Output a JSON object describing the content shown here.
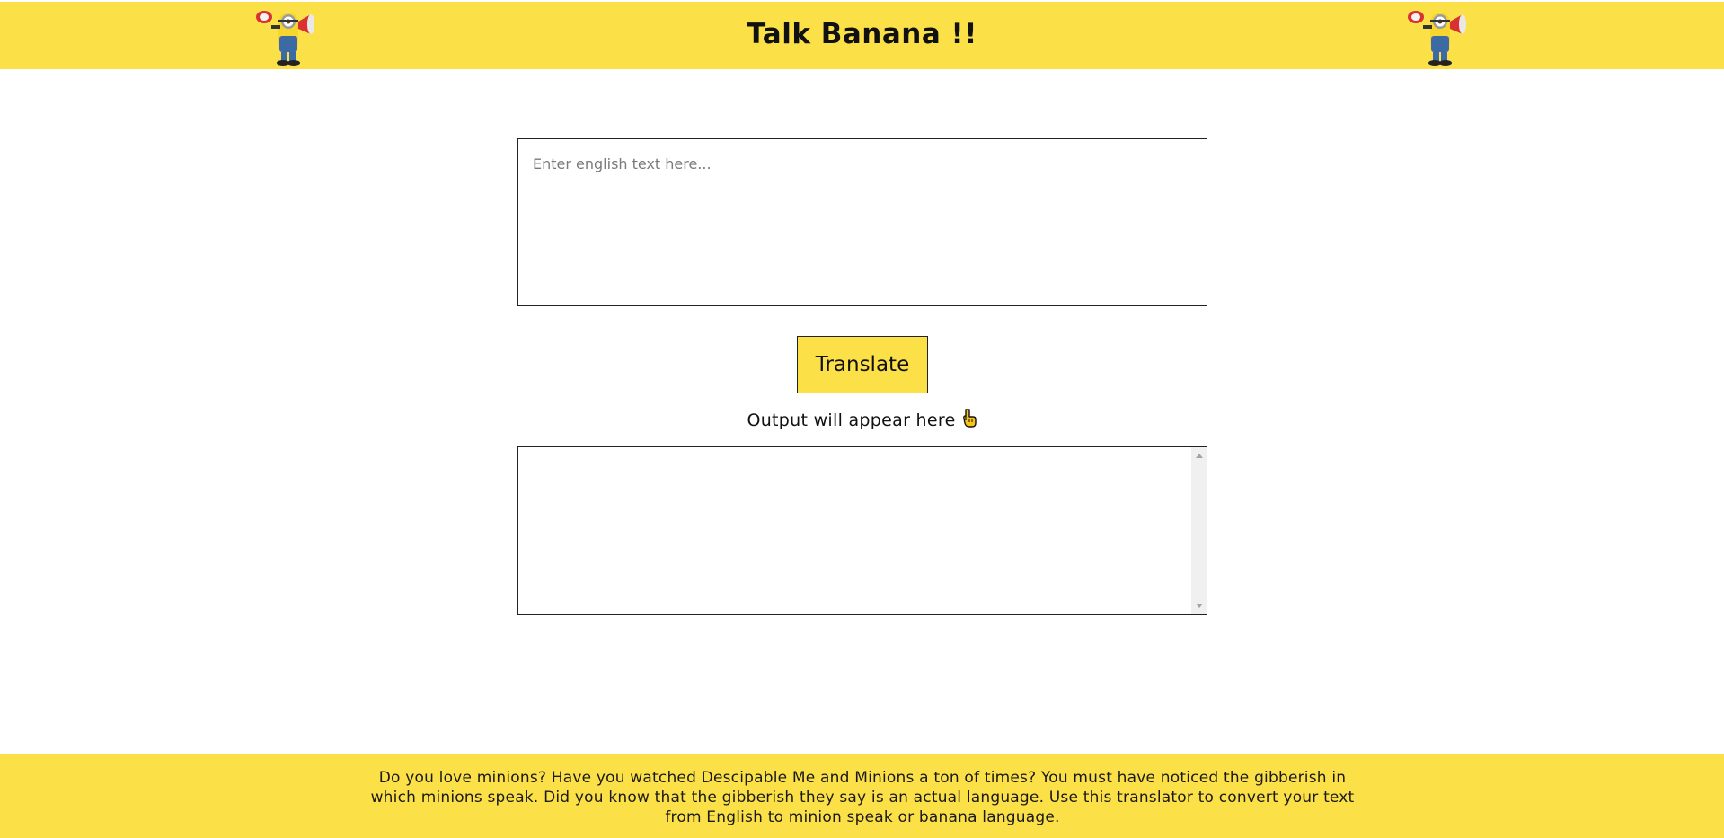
{
  "header": {
    "title": "Talk Banana !!",
    "left_image": "minion-with-megaphone",
    "right_image": "minion-with-megaphone"
  },
  "input": {
    "placeholder": "Enter english text here...",
    "value": ""
  },
  "translate_button": {
    "label": "Translate"
  },
  "output": {
    "caption": "Output will appear here",
    "caption_icon": "hand-pointing-down-icon",
    "value": ""
  },
  "footer": {
    "text": "Do you love minions? Have you watched Descipable Me and Minions a ton of times? You must have noticed the gibberish in which minions speak. Did you know that the gibberish they say is an actual language. Use this translator to convert your text from English to minion speak or banana language."
  },
  "colors": {
    "accent": "#fce047",
    "border": "#222222",
    "background": "#ffffff"
  }
}
